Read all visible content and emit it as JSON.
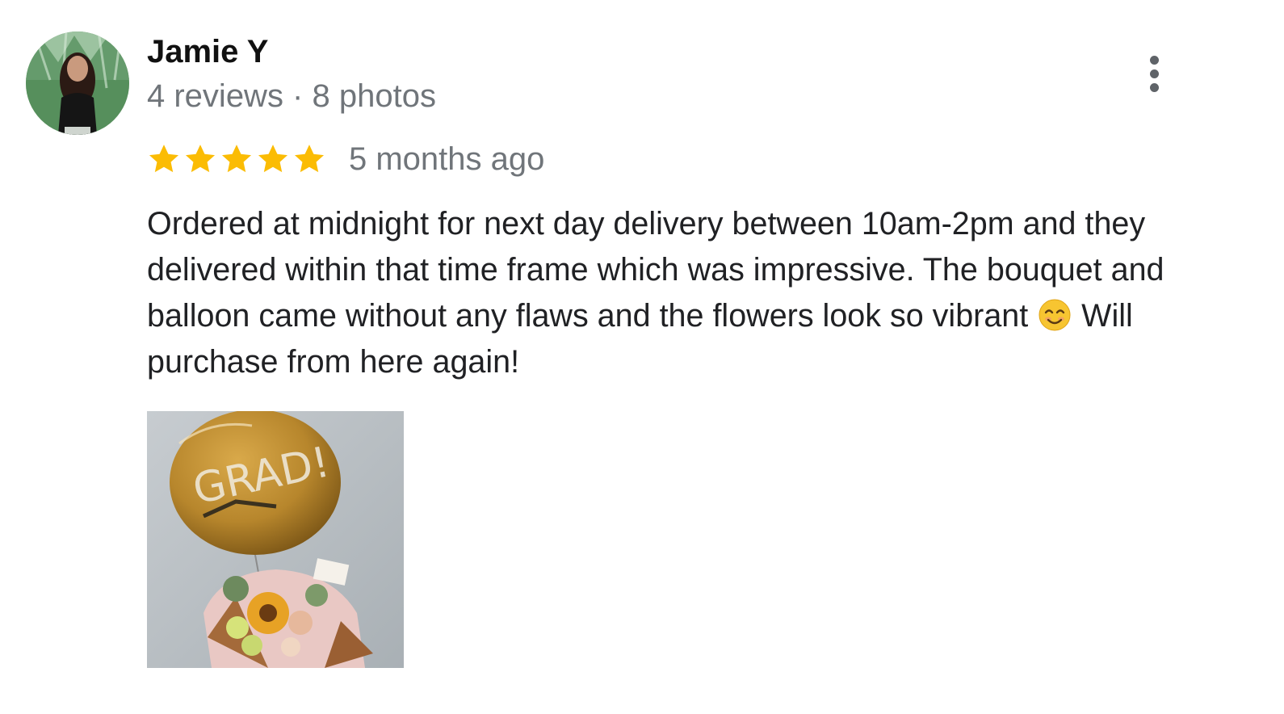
{
  "reviewer": {
    "name": "Jamie Y",
    "meta": "4 reviews · 8 photos"
  },
  "rating": {
    "stars": 5,
    "max": 5,
    "date": "5 months ago"
  },
  "review": {
    "text_before_emoji": "Ordered at midnight for next day delivery between 10am-2pm and they delivered within that time frame which was impressive. The bouquet and balloon came without any flaws and the flowers look so vibrant ",
    "text_after_emoji": " Will purchase from here again!"
  },
  "photo": {
    "balloon_text": "GRAD!"
  },
  "icons": {
    "more": "more-vert-icon",
    "star": "star-icon",
    "emoji": "smiling-face-icon"
  },
  "colors": {
    "star": "#fbbc04",
    "secondary_text": "#70757a",
    "primary_text": "#202124"
  }
}
